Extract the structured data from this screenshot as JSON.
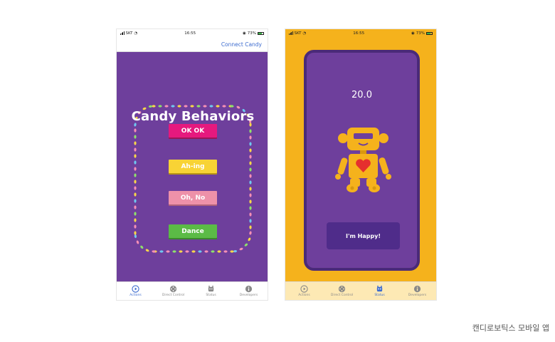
{
  "left_phone": {
    "status": {
      "carrier": "SKT",
      "time": "16:55",
      "battery": "73%",
      "battery_level": 0.73
    },
    "nav": {
      "connect_label": "Connect Candy"
    },
    "title": "Candy Behaviors",
    "buttons": [
      {
        "label": "OK OK",
        "color": "#e6197e"
      },
      {
        "label": "Ah-ing",
        "color": "#f8d335"
      },
      {
        "label": "Oh, No",
        "color": "#ee91a9"
      },
      {
        "label": "Dance",
        "color": "#5bbb46"
      }
    ],
    "tabs": [
      {
        "label": "Actions",
        "icon": "play-icon",
        "active": true
      },
      {
        "label": "Direct Control",
        "icon": "dpad-icon",
        "active": false
      },
      {
        "label": "Status",
        "icon": "robot-face-icon",
        "active": false
      },
      {
        "label": "Developers",
        "icon": "info-icon",
        "active": false
      }
    ]
  },
  "right_phone": {
    "status": {
      "carrier": "SKT",
      "time": "16:55",
      "battery": "73%",
      "battery_level": 0.73
    },
    "timer": "20.0",
    "happy_label": "I'm Happy!",
    "tabs": [
      {
        "label": "Actions",
        "icon": "play-icon",
        "active": false
      },
      {
        "label": "Direct Control",
        "icon": "dpad-icon",
        "active": false
      },
      {
        "label": "Status",
        "icon": "robot-face-icon",
        "active": true
      },
      {
        "label": "Developers",
        "icon": "info-icon",
        "active": false
      }
    ]
  },
  "caption": "캔디로보틱스 모바일 앱",
  "colors": {
    "purple": "#6e3f9c",
    "orange": "#f5b21c",
    "accent_blue": "#3d6ccf",
    "dot_colors": [
      "#f7d64a",
      "#8ee06b",
      "#f58fb5",
      "#6fc7f0",
      "#f7d64a",
      "#f58fb5"
    ]
  }
}
